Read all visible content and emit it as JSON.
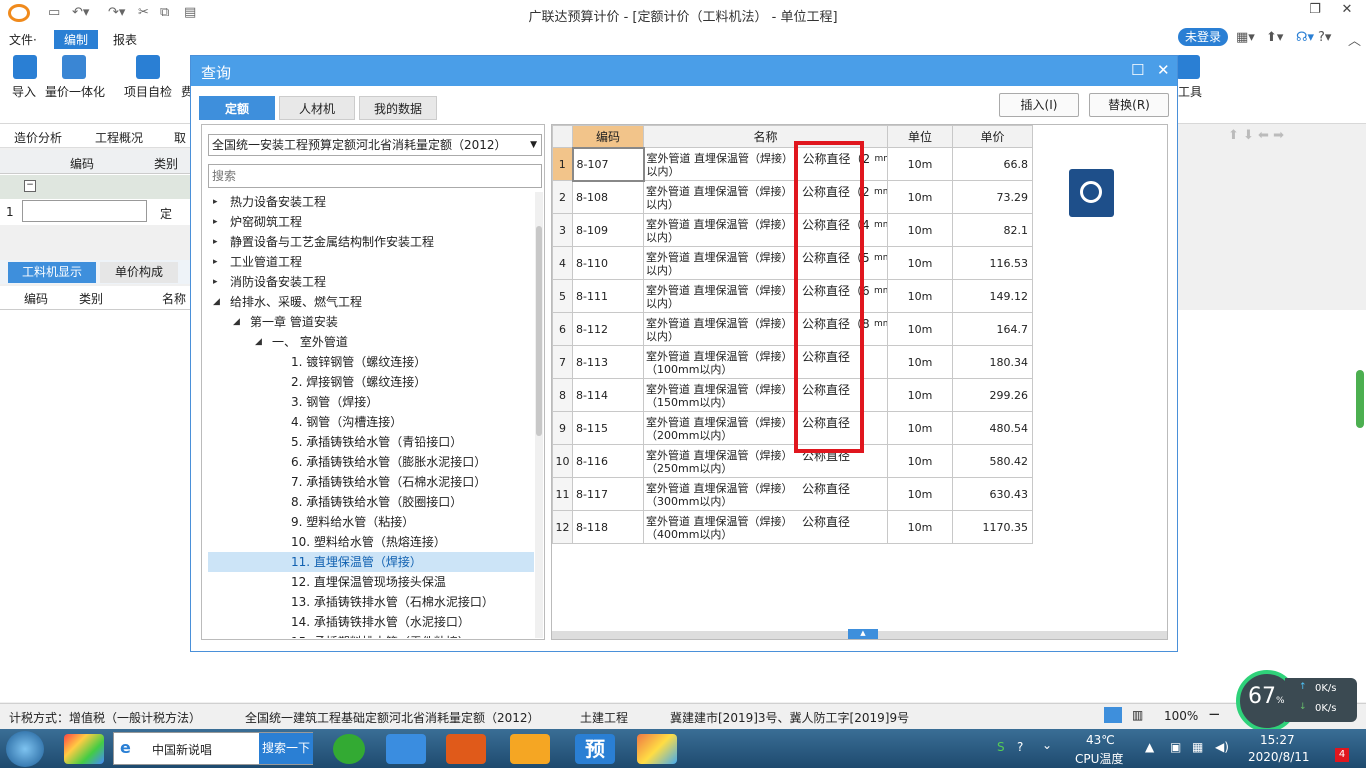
{
  "app": {
    "title": "广联达预算计价 - [定额计价（工料机法） - 单位工程]"
  },
  "menu": {
    "items": [
      "文件·",
      "编制",
      "报表"
    ],
    "login": "未登录"
  },
  "ribbon": {
    "buttons": [
      "导入",
      "量价一体化",
      "项目自检",
      "费"
    ],
    "right_label": "工具"
  },
  "subtabs": [
    "造价分析",
    "工程概况",
    "取"
  ],
  "leftgrid": {
    "headers": [
      "编码",
      "类别"
    ],
    "row_num": "1",
    "row_type": "定"
  },
  "lower": {
    "tabs": [
      "工料机显示",
      "单价构成"
    ],
    "headers": [
      "编码",
      "类别",
      "名称"
    ]
  },
  "dialog": {
    "title": "查询",
    "tabs": [
      "定额",
      "人材机",
      "我的数据"
    ],
    "insert_btn": "插入(I)",
    "replace_btn": "替换(R)",
    "quota_select": "全国统一安装工程预算定额河北省消耗量定额（2012）",
    "search_placeholder": "搜索",
    "tree": [
      {
        "label": "热力设备安装工程",
        "level": 0,
        "arrow": "▸"
      },
      {
        "label": "炉窑砌筑工程",
        "level": 0,
        "arrow": "▸"
      },
      {
        "label": "静置设备与工艺金属结构制作安装工程",
        "level": 0,
        "arrow": "▸"
      },
      {
        "label": "工业管道工程",
        "level": 0,
        "arrow": "▸"
      },
      {
        "label": "消防设备安装工程",
        "level": 0,
        "arrow": "▸"
      },
      {
        "label": "给排水、采暖、燃气工程",
        "level": 0,
        "arrow": "◢"
      },
      {
        "label": "第一章 管道安装",
        "level": 1,
        "arrow": "◢"
      },
      {
        "label": "一、 室外管道",
        "level": 2,
        "arrow": "◢"
      },
      {
        "label": "1. 镀锌钢管（螺纹连接）",
        "level": 3
      },
      {
        "label": "2. 焊接钢管（螺纹连接）",
        "level": 3
      },
      {
        "label": "3. 钢管（焊接）",
        "level": 3
      },
      {
        "label": "4. 钢管（沟槽连接）",
        "level": 3
      },
      {
        "label": "5. 承插铸铁给水管（青铅接口）",
        "level": 3
      },
      {
        "label": "6. 承插铸铁给水管（膨胀水泥接口）",
        "level": 3
      },
      {
        "label": "7. 承插铸铁给水管（石棉水泥接口）",
        "level": 3
      },
      {
        "label": "8. 承插铸铁给水管（胶圈接口）",
        "level": 3
      },
      {
        "label": "9. 塑料给水管（粘接）",
        "level": 3
      },
      {
        "label": "10. 塑料给水管（热熔连接）",
        "level": 3
      },
      {
        "label": "11. 直埋保温管（焊接）",
        "level": 3,
        "selected": true
      },
      {
        "label": "12. 直埋保温管现场接头保温",
        "level": 3
      },
      {
        "label": "13. 承插铸铁排水管（石棉水泥接口）",
        "level": 3
      },
      {
        "label": "14. 承插铸铁排水管（水泥接口）",
        "level": 3
      },
      {
        "label": "15. 承插塑料排水管（零件粘接）",
        "level": 3
      }
    ],
    "table": {
      "headers": [
        "",
        "编码",
        "名称",
        "单位",
        "单价"
      ],
      "rows": [
        {
          "n": "1",
          "code": "8-107",
          "name1": "室外管道 直埋保温管（焊接）",
          "name2": "以内）",
          "spec": "公称直径（2",
          "mm": "mm",
          "unit": "10m",
          "price": "66.8"
        },
        {
          "n": "2",
          "code": "8-108",
          "name1": "室外管道 直埋保温管（焊接）",
          "name2": "以内）",
          "spec": "公称直径（2",
          "mm": "mm",
          "unit": "10m",
          "price": "73.29"
        },
        {
          "n": "3",
          "code": "8-109",
          "name1": "室外管道 直埋保温管（焊接）",
          "name2": "以内）",
          "spec": "公称直径（4",
          "mm": "mm",
          "unit": "10m",
          "price": "82.1"
        },
        {
          "n": "4",
          "code": "8-110",
          "name1": "室外管道 直埋保温管（焊接）",
          "name2": "以内）",
          "spec": "公称直径（5",
          "mm": "mm",
          "unit": "10m",
          "price": "116.53"
        },
        {
          "n": "5",
          "code": "8-111",
          "name1": "室外管道 直埋保温管（焊接）",
          "name2": "以内）",
          "spec": "公称直径（6",
          "mm": "mm",
          "unit": "10m",
          "price": "149.12"
        },
        {
          "n": "6",
          "code": "8-112",
          "name1": "室外管道 直埋保温管（焊接）",
          "name2": "以内）",
          "spec": "公称直径（8",
          "mm": "mm",
          "unit": "10m",
          "price": "164.7"
        },
        {
          "n": "7",
          "code": "8-113",
          "name1": "室外管道 直埋保温管（焊接）",
          "name2": "（100mm以内）",
          "spec": "公称直径",
          "mm": "",
          "unit": "10m",
          "price": "180.34"
        },
        {
          "n": "8",
          "code": "8-114",
          "name1": "室外管道 直埋保温管（焊接）",
          "name2": "（150mm以内）",
          "spec": "公称直径",
          "mm": "",
          "unit": "10m",
          "price": "299.26"
        },
        {
          "n": "9",
          "code": "8-115",
          "name1": "室外管道 直埋保温管（焊接）",
          "name2": "（200mm以内）",
          "spec": "公称直径",
          "mm": "",
          "unit": "10m",
          "price": "480.54"
        },
        {
          "n": "10",
          "code": "8-116",
          "name1": "室外管道 直埋保温管（焊接）",
          "name2": "（250mm以内）",
          "spec": "公称直径",
          "mm": "",
          "unit": "10m",
          "price": "580.42"
        },
        {
          "n": "11",
          "code": "8-117",
          "name1": "室外管道 直埋保温管（焊接）",
          "name2": "（300mm以内）",
          "spec": "公称直径",
          "mm": "",
          "unit": "10m",
          "price": "630.43"
        },
        {
          "n": "12",
          "code": "8-118",
          "name1": "室外管道 直埋保温管（焊接）",
          "name2": "（400mm以内）",
          "spec": "公称直径",
          "mm": "",
          "unit": "10m",
          "price": "1170.35"
        }
      ]
    }
  },
  "status": {
    "tax": "计税方式：增值税（一般计税方法）",
    "quota": "全国统一建筑工程基础定额河北省消耗量定额（2012）",
    "category": "土建工程",
    "doc": "冀建建市[2019]3号、冀人防工字[2019]9号",
    "zoom": "100%"
  },
  "taskbar": {
    "app_text": "中国新说唱",
    "search_btn": "搜索一下",
    "yu_label": "预",
    "temp": "43℃",
    "temp_label": "CPU温度",
    "time": "15:27",
    "date": "2020/8/11",
    "badge": "4",
    "gauge_value": "67",
    "gauge_unit": "%",
    "up_speed": "0K/s",
    "down_speed": "0K/s"
  },
  "colors": {
    "accent": "#2a7fd4",
    "dialog_title": "#4a9ee8",
    "highlight_red": "#e0161e",
    "selected_code": "#f2c48a"
  }
}
